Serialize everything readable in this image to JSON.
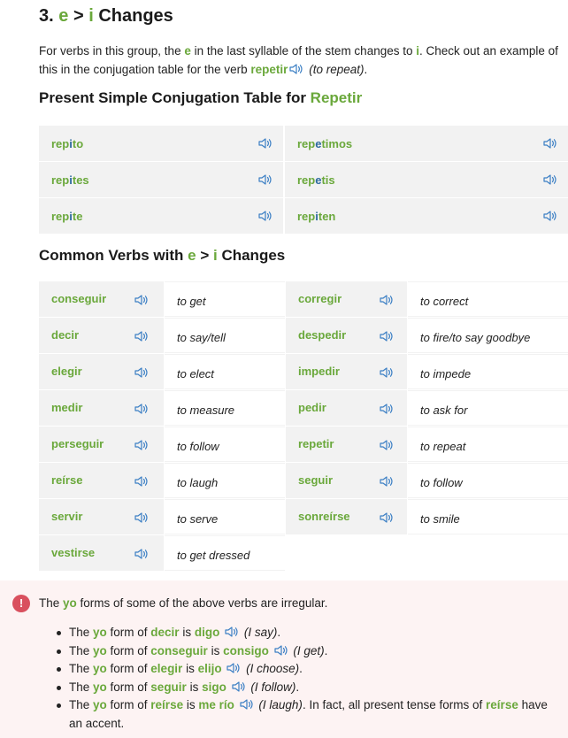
{
  "section": {
    "number": "3.",
    "letter_from": "e",
    "arrow": ">",
    "letter_to": "i",
    "title_rest": "Changes"
  },
  "intro": {
    "p1": "For verbs in this group, the ",
    "e": "e",
    "p2": " in the last syllable of the stem changes to ",
    "i": "i",
    "p3": ". Check out an example of this in the conjugation table for the verb ",
    "verb": "repetir",
    "gloss": "(to repeat)",
    "end": "."
  },
  "conj_heading": {
    "text": "Present Simple Conjugation Table for ",
    "verb": "Repetir"
  },
  "conjugation": [
    {
      "left": {
        "stem": "rep",
        "chg": "i",
        "end": "to"
      },
      "right": {
        "stem": "rep",
        "chg": "e",
        "end": "timos"
      }
    },
    {
      "left": {
        "stem": "rep",
        "chg": "i",
        "end": "tes"
      },
      "right": {
        "stem": "rep",
        "chg": "e",
        "end": "tis"
      }
    },
    {
      "left": {
        "stem": "rep",
        "chg": "i",
        "end": "te"
      },
      "right": {
        "stem": "rep",
        "chg": "i",
        "end": "ten"
      }
    }
  ],
  "common_heading": {
    "text": "Common Verbs with ",
    "e": "e",
    "arrow": " > ",
    "i": "i",
    "rest": " Changes"
  },
  "verbs": [
    {
      "v1": "conseguir",
      "t1": "to get",
      "v2": "corregir",
      "t2": "to correct"
    },
    {
      "v1": "decir",
      "t1": "to say/tell",
      "v2": "despedir",
      "t2": "to fire/to say goodbye"
    },
    {
      "v1": "elegir",
      "t1": "to elect",
      "v2": "impedir",
      "t2": "to impede"
    },
    {
      "v1": "medir",
      "t1": "to measure",
      "v2": "pedir",
      "t2": "to ask for"
    },
    {
      "v1": "perseguir",
      "t1": "to follow",
      "v2": "repetir",
      "t2": "to repeat"
    },
    {
      "v1": "reírse",
      "t1": "to laugh",
      "v2": "seguir",
      "t2": "to follow"
    },
    {
      "v1": "servir",
      "t1": "to serve",
      "v2": "sonreírse",
      "t2": "to smile"
    },
    {
      "v1": "vestirse",
      "t1": "to get dressed",
      "v2": "",
      "t2": ""
    }
  ],
  "note": {
    "icon": "!",
    "head_pre": "The ",
    "head_yo": "yo",
    "head_post": " forms of some of the above verbs are irregular.",
    "items": [
      {
        "a": "The ",
        "yo": "yo",
        "b": " form of ",
        "verb": "decir",
        "c": " is ",
        "form": "digo",
        "gloss": "(I say)",
        "d": "."
      },
      {
        "a": "The ",
        "yo": "yo",
        "b": " form of ",
        "verb": "conseguir",
        "c": " is ",
        "form": "consigo",
        "gloss": "(I get)",
        "d": "."
      },
      {
        "a": "The ",
        "yo": "yo",
        "b": " form of ",
        "verb": "elegir",
        "c": " is ",
        "form": "elijo",
        "gloss": "(I choose)",
        "d": "."
      },
      {
        "a": "The ",
        "yo": "yo",
        "b": " form of ",
        "verb": "seguir",
        "c": " is ",
        "form": "sigo",
        "gloss": "(I follow)",
        "d": "."
      },
      {
        "a": "The ",
        "yo": "yo",
        "b": " form of ",
        "verb": "reírse",
        "c": " is ",
        "form": "me río",
        "gloss": "(I laugh)",
        "d": ". In fact, all present tense forms of ",
        "verb2": "reírse",
        "e": " have an accent."
      }
    ]
  },
  "colors": {
    "green": "#6aa83b",
    "blue": "#2d6a9f",
    "note_bg": "#fdf3f3",
    "alert": "#d9505e"
  }
}
